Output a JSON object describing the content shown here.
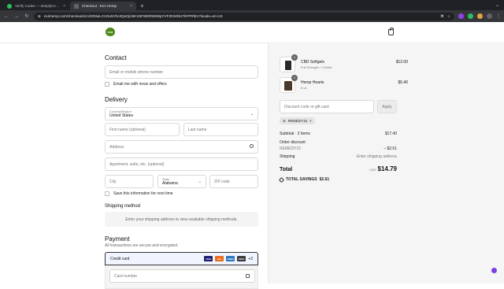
{
  "browser": {
    "tabs": [
      {
        "title": "Verify Codes — SimplyCodes",
        "active": false
      },
      {
        "title": "Checkout - Evo Hemp",
        "active": true
      }
    ],
    "new_tab": "+",
    "url": "evohemp.com/checkouts/cn/Z2NwLXVzLWVhc3QxOjA5K1NFWDRWN0pYVFZNNXlUTkFPRlE1?locale=en-US"
  },
  "header": {
    "logo_text": "evo"
  },
  "contact": {
    "heading": "Contact",
    "email_placeholder": "Email or mobile phone number",
    "newsletter_label": "Email me with news and offers"
  },
  "delivery": {
    "heading": "Delivery",
    "country_label": "Country/Region",
    "country_value": "United States",
    "first_name": "First name (optional)",
    "last_name": "Last name",
    "address": "Address",
    "apartment": "Apartment, suite, etc. (optional)",
    "city": "City",
    "state_label": "State",
    "state_value": "Alabama",
    "zip": "ZIP code",
    "save_info_label": "Save this information for next time"
  },
  "shipping": {
    "heading": "Shipping method",
    "message": "Enter your shipping address to view available shipping methods."
  },
  "payment": {
    "heading": "Payment",
    "subtext": "All transactions are secure and encrypted.",
    "method_label": "Credit card",
    "card_logos": [
      "VISA",
      "MC",
      "AMEX",
      "DISC"
    ],
    "more_cards": "+2",
    "card_number_placeholder": "Card number"
  },
  "summary": {
    "items": [
      {
        "qty": "1",
        "name": "CBD Softgels",
        "variant": "Full Strength / 1 Bottle",
        "price": "$12.00"
      },
      {
        "qty": "1",
        "name": "Hemp Hearts",
        "variant": "8 oz",
        "price": "$5.40"
      }
    ],
    "discount_placeholder": "Discount code or gift card",
    "apply_label": "Apply",
    "applied_code": "REMEDY15",
    "subtotal_label": "Subtotal · 2 items",
    "subtotal_value": "$17.40",
    "order_discount_label": "Order discount",
    "discount_code_label": "REMEDY15",
    "discount_value": "– $2.61",
    "shipping_label": "Shipping",
    "shipping_value": "Enter shipping address",
    "total_label": "Total",
    "currency": "USD",
    "total_value": "$14.79",
    "savings_label": "TOTAL SAVINGS",
    "savings_value": "$2.61"
  },
  "colors": {
    "brand_green": "#4d8a1c",
    "accent_dark": "#111111",
    "summary_bg": "#f5f5f5"
  }
}
